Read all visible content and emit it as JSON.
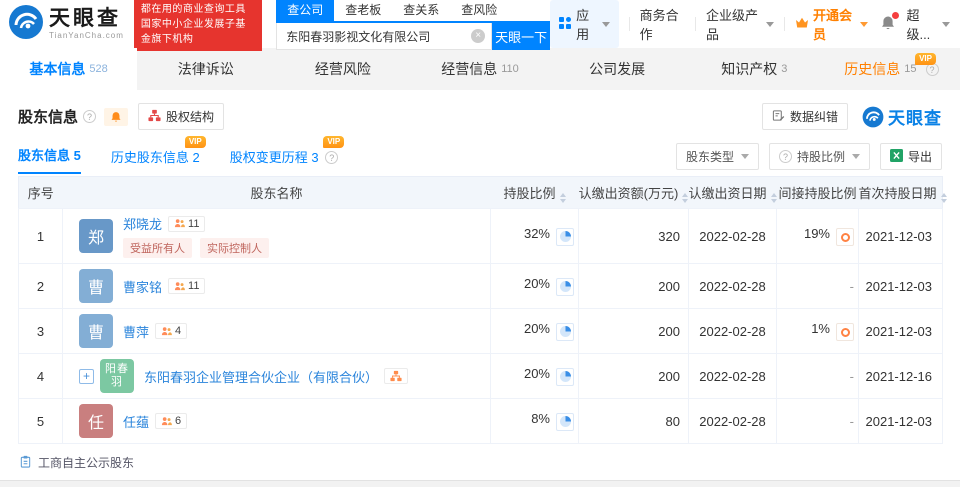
{
  "header": {
    "logo": {
      "title": "天眼查",
      "subtitle": "TianYanCha.com"
    },
    "promo": {
      "line1": "都在用的商业查询工具",
      "line2": "国家中小企业发展子基金旗下机构"
    },
    "search": {
      "tabs": [
        "查公司",
        "查老板",
        "查关系",
        "查风险"
      ],
      "active_tab": "查公司",
      "value": "东阳春羽影视文化有限公司",
      "button": "天眼一下"
    },
    "menu": {
      "apps": "应用",
      "business": "商务合作",
      "enterprise": "企业级产品",
      "vip": "开通会员",
      "user": "超级..."
    }
  },
  "nav_tabs": [
    {
      "label": "基本信息",
      "count": "528"
    },
    {
      "label": "法律诉讼",
      "count": ""
    },
    {
      "label": "经营风险",
      "count": ""
    },
    {
      "label": "经营信息",
      "count": "110"
    },
    {
      "label": "公司发展",
      "count": ""
    },
    {
      "label": "知识产权",
      "count": "3"
    },
    {
      "label": "历史信息",
      "count": "15",
      "vip": "VIP"
    }
  ],
  "section": {
    "title": "股东信息",
    "equity_structure_button": "股权结构",
    "data_correction_button": "数据纠错",
    "brand_watermark": "天眼查",
    "sub_tabs": [
      {
        "label": "股东信息",
        "count": "5"
      },
      {
        "label": "历史股东信息",
        "count": "2",
        "vip": "VIP"
      },
      {
        "label": "股权变更历程",
        "count": "3",
        "vip": "VIP"
      }
    ],
    "filters": {
      "shareholder_type": "股东类型",
      "holding_ratio": "持股比例"
    },
    "export_label": "导出",
    "footnote": "工商自主公示股东"
  },
  "table": {
    "columns": [
      "序号",
      "股东名称",
      "持股比例",
      "认缴出资额(万元)",
      "认缴出资日期",
      "间接持股比例",
      "首次持股日期"
    ],
    "sortable_columns": [
      "持股比例",
      "认缴出资额(万元)",
      "认缴出资日期",
      "首次持股日期"
    ],
    "rows": [
      {
        "seq": "1",
        "avatar": "郑",
        "name": "郑晓龙",
        "badge": "11",
        "tags": [
          "受益所有人",
          "实际控制人"
        ],
        "ratio": "32%",
        "amount": "320",
        "date": "2022-02-28",
        "indirect": "19%",
        "first_date": "2021-12-03"
      },
      {
        "seq": "2",
        "avatar": "曹",
        "name": "曹家铭",
        "badge": "11",
        "ratio": "20%",
        "amount": "200",
        "date": "2022-02-28",
        "indirect": "-",
        "first_date": "2021-12-03"
      },
      {
        "seq": "3",
        "avatar": "曹",
        "name": "曹萍",
        "badge": "4",
        "ratio": "20%",
        "amount": "200",
        "date": "2022-02-28",
        "indirect": "1%",
        "first_date": "2021-12-03"
      },
      {
        "seq": "4",
        "avatar": "阳春羽",
        "expand": "+",
        "name": "东阳春羽企业管理合伙企业（有限合伙）",
        "ratio": "20%",
        "amount": "200",
        "date": "2022-02-28",
        "indirect": "-",
        "first_date": "2021-12-16"
      },
      {
        "seq": "5",
        "avatar": "任",
        "name": "任蕴",
        "badge": "6",
        "ratio": "8%",
        "amount": "80",
        "date": "2022-02-28",
        "indirect": "-",
        "first_date": "2021-12-03"
      }
    ]
  },
  "icons": {
    "logo": "blue-eye-swirl-circle",
    "search_clear": "gray-circle-x",
    "app_grid": "blue-grid-squares",
    "vip_crown": "orange-crown",
    "notification": "bell-with-red-dot",
    "help": "circled-question-mark",
    "section_bell": "orange-bell",
    "equity_structure": "red-org-chart",
    "data_correction": "edit-document",
    "export_excel": "green-excel-square",
    "pie_ratio": "blue-pie-chart",
    "indirect_ratio": "orange-donut",
    "partner_badge": "orange-two-people",
    "company_structure_badge": "orange-org-chart",
    "footnote": "blue-clipboard",
    "sort": "up-down-triangles"
  },
  "colors": {
    "accent_blue": "#0084ff",
    "promo_red": "#e6342e",
    "orange": "#ff8000",
    "table_header_bg": "#f2f6fb",
    "tag_bg": "#fdf0ee",
    "tag_text": "#c0665e",
    "avatar_blue_dark": "#6898c8",
    "avatar_blue_light": "#83aed5",
    "avatar_green": "#7cc8a2",
    "avatar_red": "#c97f7f"
  }
}
